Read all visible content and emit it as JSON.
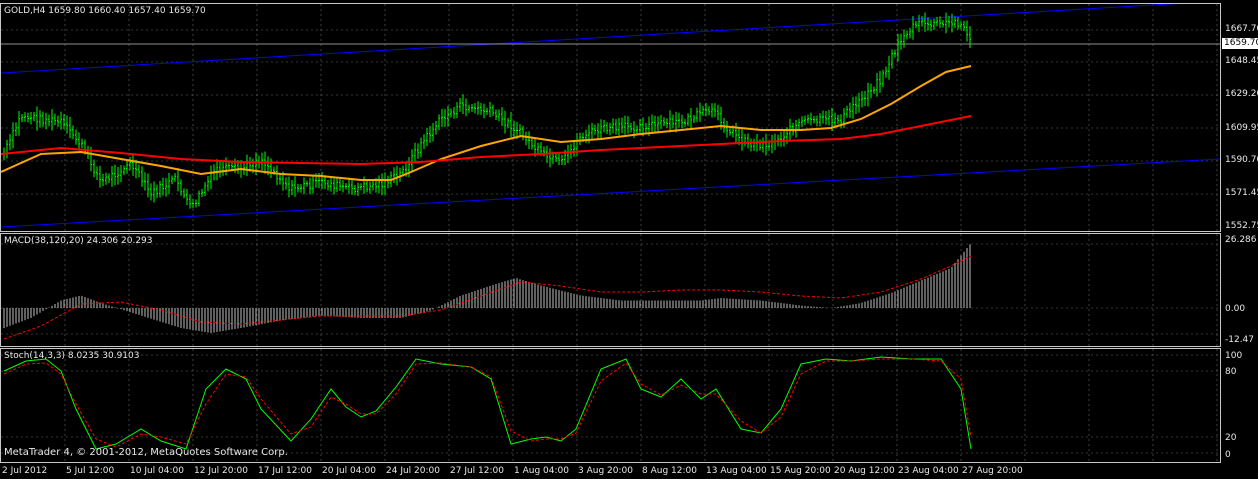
{
  "main": {
    "header": "GOLD,H4  1659.80 1660.40 1657.40 1659.70",
    "current_price": "1659.70",
    "yticks": [
      "1667.70",
      "1648.45",
      "1629.20",
      "1609.95",
      "1590.70",
      "1571.45",
      "1552.75"
    ]
  },
  "macd": {
    "header": "MACD(38,120,20) 24.306 20.293",
    "yticks": [
      "26.286",
      "0.00",
      "-12.47"
    ]
  },
  "stoch": {
    "header": "Stoch(14,3,3) 8.0235 30.9103",
    "yticks": [
      "100",
      "80",
      "20",
      "0"
    ]
  },
  "copyright": "MetaTrader 4, © 2001-2012, MetaQuotes Software Corp.",
  "xticks": [
    "2 Jul 2012",
    "5 Jul 12:00",
    "10 Jul 04:00",
    "12 Jul 20:00",
    "17 Jul 12:00",
    "20 Jul 04:00",
    "24 Jul 20:00",
    "27 Jul 12:00",
    "1 Aug 04:00",
    "3 Aug 20:00",
    "8 Aug 12:00",
    "13 Aug 04:00",
    "15 Aug 20:00",
    "20 Aug 12:00",
    "23 Aug 04:00",
    "27 Aug 20:00"
  ],
  "colors": {
    "candles": "#00ff00",
    "ma_fast": "#ffa500",
    "ma_slow": "#ff0000",
    "channel": "#0000ff",
    "macd_hist": "#c0c0c0",
    "macd_signal": "#ff0000",
    "stoch_main": "#00ff00",
    "stoch_signal": "#ff0000",
    "grid": "#c0c0c0"
  }
}
